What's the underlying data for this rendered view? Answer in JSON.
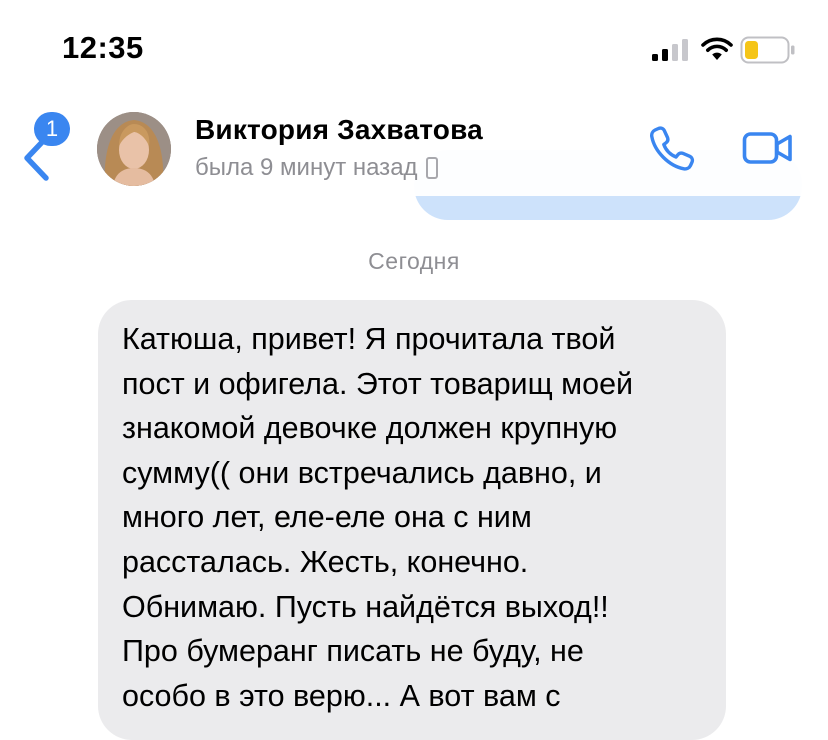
{
  "status_bar": {
    "time": "12:35"
  },
  "header": {
    "back_badge": "1",
    "contact_name": "Виктория Захватова",
    "contact_status": "была 9 минут назад",
    "accent_color": "#3a86f0"
  },
  "chat": {
    "day_separator": "Сегодня",
    "incoming_message": {
      "text": "Катюша, привет! Я прочитала твой\nпост и офигела. Этот товарищ моей\nзнакомой девочке должен крупную\nсумму(( они встречались давно, и\nмного лет, еле-еле она с ним\nрассталась. Жесть, конечно.\nОбнимаю. Пусть найдётся выход!!\nПро бумеранг писать не буду, не\nособо в это верю... А вот вам с",
      "bubble_color": "#ebebed"
    },
    "outgoing_bubble_color": "#cde2fb"
  },
  "icons": {
    "back": "chevron-left-icon",
    "call": "phone-icon",
    "video": "video-camera-icon",
    "device": "mobile-device-icon",
    "signal": "cellular-signal-icon",
    "wifi": "wifi-icon",
    "battery": "battery-low-icon"
  }
}
